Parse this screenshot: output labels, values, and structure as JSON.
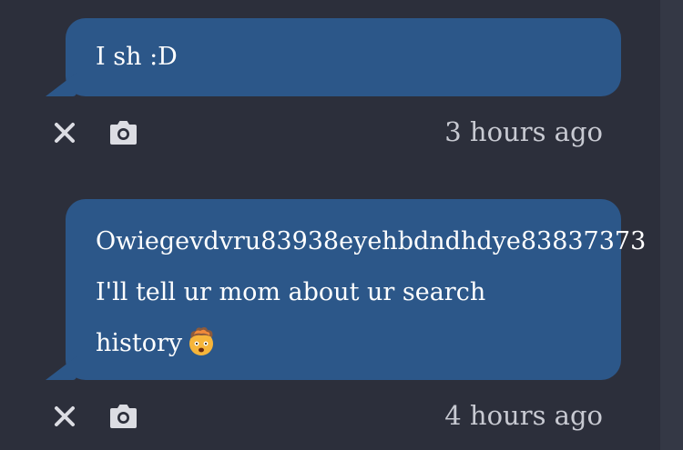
{
  "messages": [
    {
      "lines": [
        "I sh :D"
      ],
      "timestamp": "3 hours ago",
      "actions": {
        "close_icon": "close-icon",
        "camera_icon": "camera-icon"
      }
    },
    {
      "lines": [
        "Owiegevdvru83938eyehbdndhdye83837373",
        "I'll tell ur mom about ur search",
        "history"
      ],
      "emoji": "exploding-head-emoji",
      "timestamp": "4 hours ago",
      "actions": {
        "close_icon": "close-icon",
        "camera_icon": "camera-icon"
      }
    }
  ],
  "colors": {
    "background": "#2c2f3b",
    "bubble": "#2c5789",
    "text": "#ffffff",
    "meta_text": "#c8cad2",
    "icon": "#dcdde3"
  }
}
